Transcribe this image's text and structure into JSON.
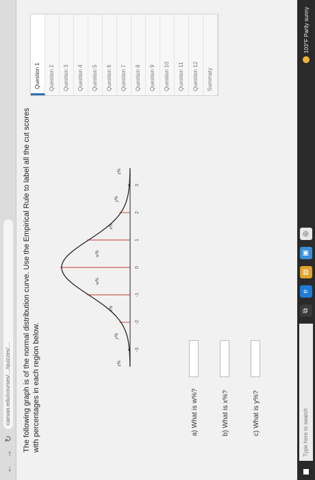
{
  "browser": {
    "url": "canvas.edu/courses/…/quizzes/…"
  },
  "question": {
    "text": "The following graph is of the normal distribution curve. Use the Empirical Rule to label all the cut scores with percentages in each region below.",
    "sub_questions": [
      {
        "label": "a) What is w%?"
      },
      {
        "label": "b) What is x%?"
      },
      {
        "label": "c) What is y%?"
      }
    ]
  },
  "graph": {
    "axis_ticks": [
      "-3",
      "-2",
      "-1",
      "0",
      "1",
      "2",
      "3"
    ],
    "region_labels": [
      "z%",
      "y%",
      "x%",
      "w%",
      "w%",
      "x%",
      "y%",
      "z%"
    ]
  },
  "question_nav": {
    "items": [
      "Question 1",
      "Question 2",
      "Question 3",
      "Question 4",
      "Question 5",
      "Question 6",
      "Question 7",
      "Question 8",
      "Question 9",
      "Question 10",
      "Question 11",
      "Question 12",
      "Summary"
    ],
    "active_index": 0
  },
  "taskbar": {
    "search_placeholder": "Type here to search",
    "weather": "103°F Partly sunny"
  },
  "colors": {
    "accent": "#2f6fb3",
    "curve": "#222222",
    "cut_lines": "#c0392b"
  }
}
